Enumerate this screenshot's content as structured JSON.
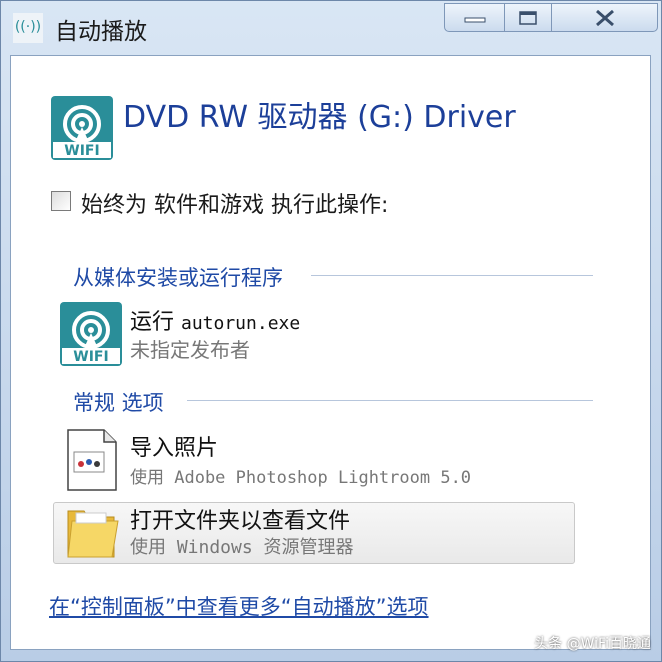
{
  "window": {
    "title": "自动播放",
    "controls": {
      "minimize": "minimize-icon",
      "maximize": "maximize-icon",
      "close": "close-icon"
    }
  },
  "header": {
    "drive_title": "DVD RW 驱动器 (G:) Driver",
    "logo_text": "WIFI"
  },
  "always": {
    "checked": false,
    "label": "始终为 软件和游戏 执行此操作:"
  },
  "sections": [
    {
      "title": "从媒体安装或运行程序",
      "items": [
        {
          "title_prefix": "运行 ",
          "title_code": "autorun.exe",
          "subtitle": "未指定发布者",
          "icon": "wifi-logo-icon",
          "icon_text": "WIFI"
        }
      ]
    },
    {
      "title": "常规 选项",
      "items": [
        {
          "title": "导入照片",
          "subtitle": "使用 Adobe Photoshop Lightroom 5.0",
          "icon": "photo-import-icon"
        },
        {
          "title": "打开文件夹以查看文件",
          "subtitle": "使用 Windows 资源管理器",
          "icon": "folder-icon"
        }
      ]
    }
  ],
  "footer": {
    "link": "在“控制面板”中查看更多“自动播放”选项"
  },
  "watermark": "头条 @WiFi百晓通",
  "colors": {
    "link_blue": "#1f4aa6",
    "logo_teal": "#2a8e99"
  }
}
